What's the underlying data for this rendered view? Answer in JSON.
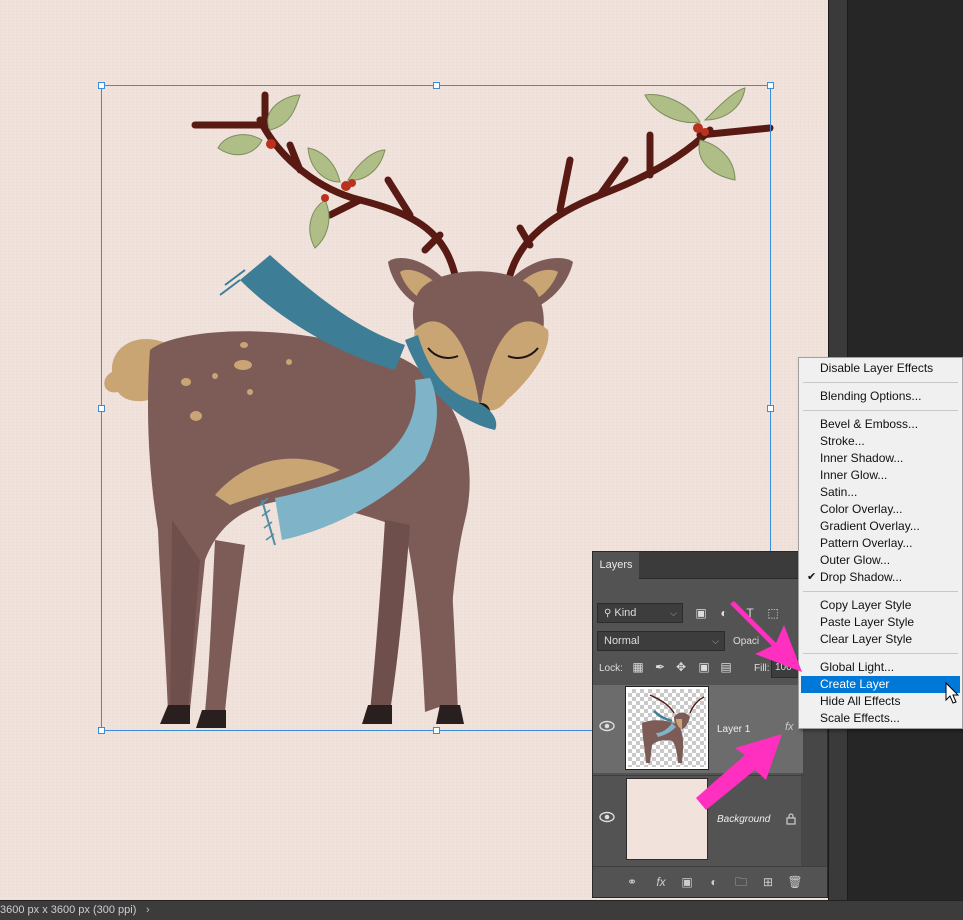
{
  "status_bar": {
    "doc_info": "3600 px x 3600 px (300 ppi)",
    "chevron": "›"
  },
  "layers_panel": {
    "tab_label": "Layers",
    "filter_kind": "Kind",
    "blend_mode": "Normal",
    "opacity_label": "Opaci",
    "lock_label": "Lock:",
    "fill_label": "Fill:",
    "fill_value": "100",
    "layers": [
      {
        "name": "Layer 1",
        "fx": "fx",
        "visible_icon": "eye-icon"
      },
      {
        "name": "Background",
        "lock_icon": "lock-icon",
        "visible_icon": "eye-icon"
      }
    ],
    "bottom_fx": "fx"
  },
  "context_menu": {
    "groups": [
      [
        "Disable Layer Effects"
      ],
      [
        "Blending Options..."
      ],
      [
        "Bevel & Emboss...",
        "Stroke...",
        "Inner Shadow...",
        "Inner Glow...",
        "Satin...",
        "Color Overlay...",
        "Gradient Overlay...",
        "Pattern Overlay...",
        "Outer Glow...",
        "Drop Shadow..."
      ],
      [
        "Copy Layer Style",
        "Paste Layer Style",
        "Clear Layer Style"
      ],
      [
        "Global Light...",
        "Create Layer",
        "Hide All Effects",
        "Scale Effects..."
      ]
    ],
    "checked_item": "Drop Shadow...",
    "highlighted_item": "Create Layer"
  },
  "colors": {
    "canvas": "#f1e3dc",
    "menu_highlight": "#0078d7",
    "arrow": "#ff2fbf",
    "selection_box": "#3d8ed9"
  }
}
